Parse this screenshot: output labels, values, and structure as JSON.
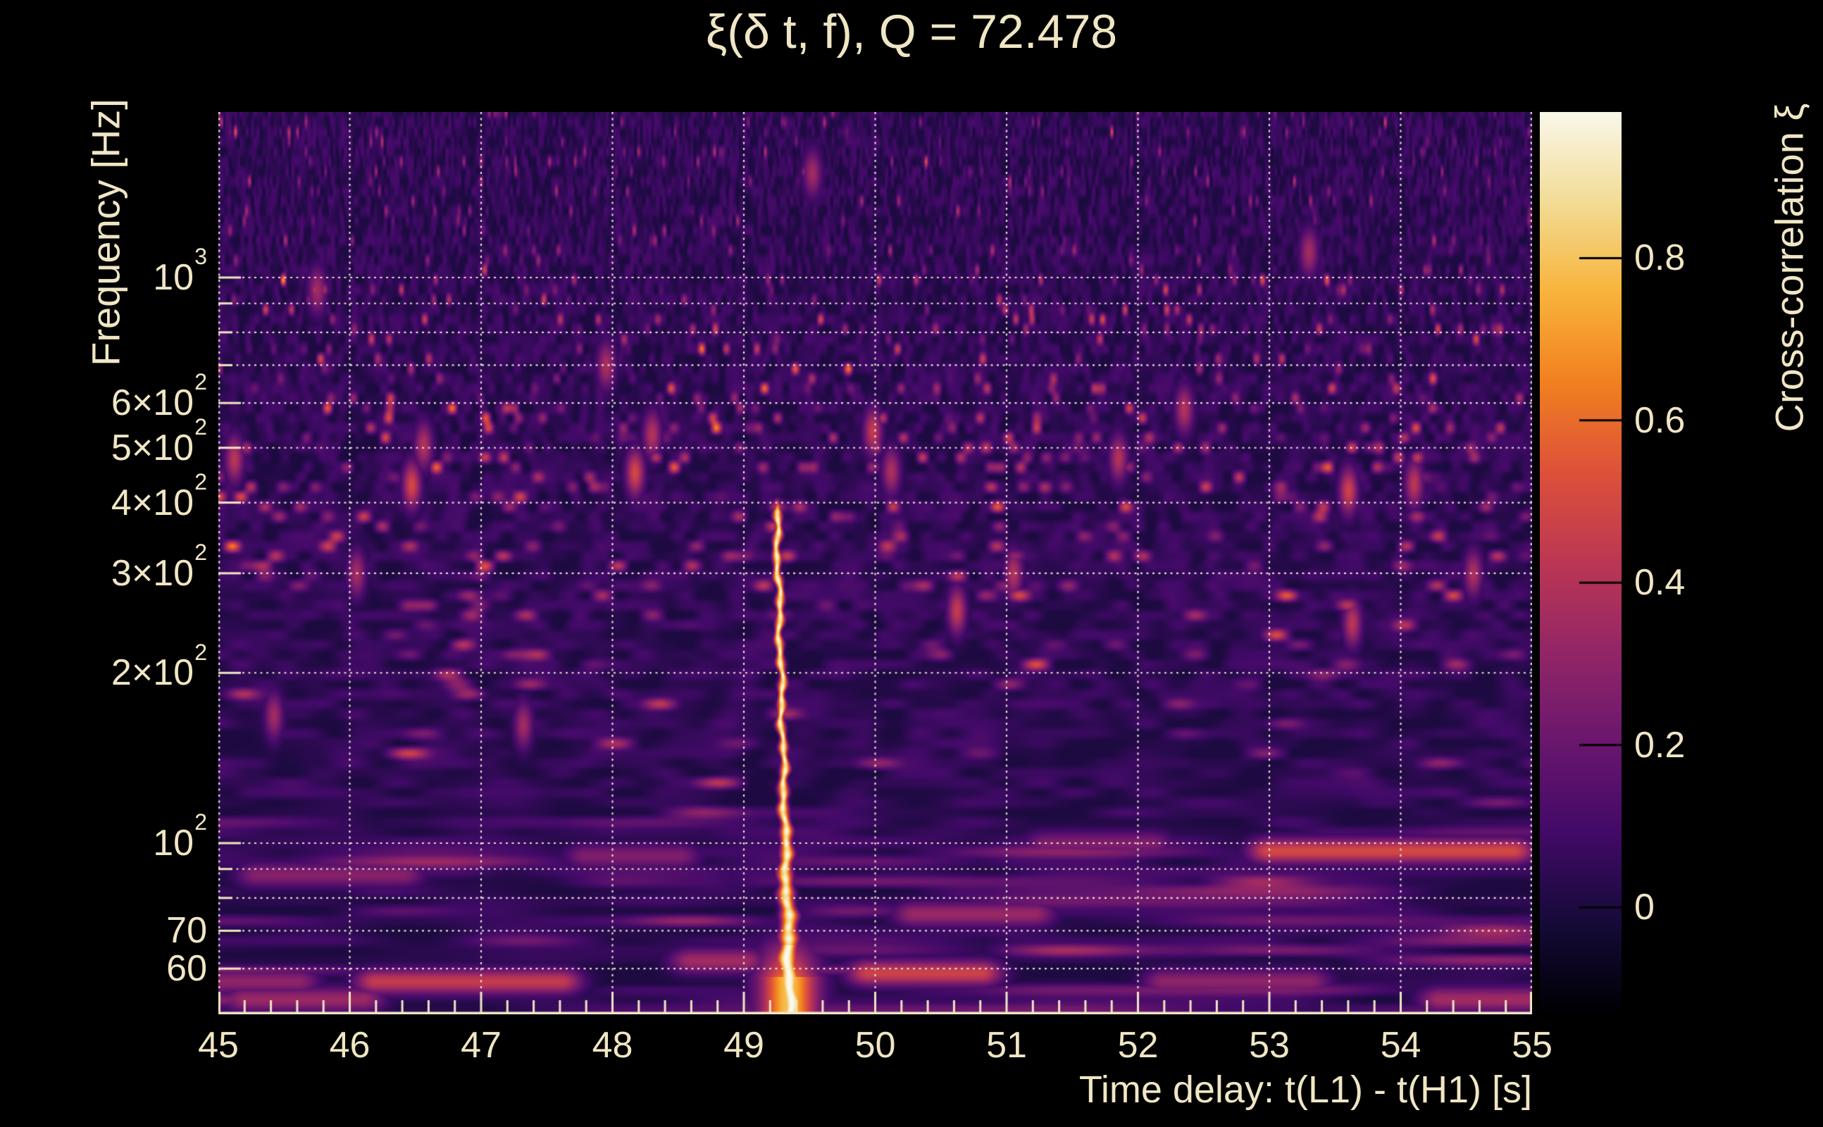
{
  "title": {
    "text": "ξ(δ t, f), Q = 72.478"
  },
  "x_axis": {
    "label": "Time delay: t(L1) - t(H1) [s]",
    "ticks": [
      {
        "t": 45,
        "label": "45"
      },
      {
        "t": 46,
        "label": "46"
      },
      {
        "t": 47,
        "label": "47"
      },
      {
        "t": 48,
        "label": "48"
      },
      {
        "t": 49,
        "label": "49"
      },
      {
        "t": 50,
        "label": "50"
      },
      {
        "t": 51,
        "label": "51"
      },
      {
        "t": 52,
        "label": "52"
      },
      {
        "t": 53,
        "label": "53"
      },
      {
        "t": 54,
        "label": "54"
      },
      {
        "t": 55,
        "label": "55"
      }
    ],
    "minor_step_s": 0.2,
    "gridline_times": [
      45,
      46,
      47,
      48,
      49,
      50,
      51,
      52,
      53,
      54,
      55
    ]
  },
  "y_axis": {
    "label": "Frequency [Hz]",
    "scale": "log",
    "ticks": [
      {
        "f": 1000,
        "m": "10",
        "e": "3"
      },
      {
        "f": 600,
        "m": "6×10",
        "e": "2"
      },
      {
        "f": 500,
        "m": "5×10",
        "e": "2"
      },
      {
        "f": 400,
        "m": "4×10",
        "e": "2"
      },
      {
        "f": 300,
        "m": "3×10",
        "e": "2"
      },
      {
        "f": 200,
        "m": "2×10",
        "e": "2"
      },
      {
        "f": 100,
        "m": "10",
        "e": "2"
      },
      {
        "f": 70,
        "m": "70"
      },
      {
        "f": 60,
        "m": "60"
      }
    ],
    "unlabeled_tick_freqs": [
      900,
      800,
      700,
      90,
      80
    ],
    "gridline_freqs": [
      60,
      70,
      80,
      90,
      100,
      200,
      300,
      400,
      500,
      600,
      700,
      800,
      900,
      1000
    ]
  },
  "colorbar": {
    "label": "Cross-correlation ξ",
    "ticks": [
      {
        "v": 0.8,
        "label": "0.8"
      },
      {
        "v": 0.6,
        "label": "0.6"
      },
      {
        "v": 0.4,
        "label": "0.4"
      },
      {
        "v": 0.2,
        "label": "0.2"
      },
      {
        "v": 0,
        "label": "0"
      }
    ],
    "vmin": -0.13,
    "vmax": 0.98,
    "colormap": "inferno-like (black → purple → red → orange → tan → white)"
  },
  "chart_data": {
    "type": "heatmap",
    "title": "ξ(δ t, f), Q = 72.478",
    "xlabel": "Time delay: t(L1) - t(H1) [s]",
    "ylabel": "Frequency [Hz]",
    "colorbar_label": "Cross-correlation ξ",
    "q_value": 72.478,
    "x_range_s": [
      45,
      55
    ],
    "y_range_hz": [
      49.8,
      1961
    ],
    "y_scale": "log",
    "color_range_xi": [
      -0.13,
      0.98
    ],
    "grid": "dotted cream gridlines at integer seconds and at log-decade frequencies",
    "legend_position": "right colorbar",
    "signal": {
      "description": "Narrow bright vertical ridge of high cross-correlation (the loudest event) at time delay ≈ 49.3 s, spanning ~50–410 Hz, saturating near ξ ≈ 0.95–1.0, wobbling slightly and widening/flaring below 70 Hz into a broad orange blob at the bottom edge",
      "t_at_400hz_s": 49.245,
      "t_at_55hz_s": 49.345,
      "freq_span_hz": [
        50,
        412
      ],
      "peak_xi": 0.97,
      "core_sigma_s_high_f": 0.02,
      "core_sigma_s_low_f": 0.053,
      "low_f_glow": {
        "below_hz": 72,
        "t_s": 49.33,
        "sigma_s": 0.16,
        "xi": 0.62
      },
      "bottom_flare": {
        "below_hz": 58,
        "t_s": 49.34,
        "sigma_s": 0.15,
        "xi": 0.8
      }
    },
    "noise": {
      "floor_xi_range": [
        -0.05,
        0.3
      ],
      "speckle_xi_range": [
        0.25,
        0.62
      ],
      "dark_band_hz": 60,
      "texture": "Q-transform tiling: tiles finer in time at high frequency, long horizontal smears below ~120 Hz"
    },
    "hotspots": [
      {
        "t_s": 46.47,
        "f_hz": 430,
        "xi": 0.5
      },
      {
        "t_s": 46.56,
        "f_hz": 505,
        "xi": 0.4
      },
      {
        "t_s": 45.12,
        "f_hz": 478,
        "xi": 0.42
      },
      {
        "t_s": 48.17,
        "f_hz": 452,
        "xi": 0.5
      },
      {
        "t_s": 48.3,
        "f_hz": 528,
        "xi": 0.4
      },
      {
        "t_s": 49.98,
        "f_hz": 535,
        "xi": 0.45
      },
      {
        "t_s": 50.12,
        "f_hz": 455,
        "xi": 0.38
      },
      {
        "t_s": 53.6,
        "f_hz": 420,
        "xi": 0.48
      },
      {
        "t_s": 53.63,
        "f_hz": 245,
        "xi": 0.42
      },
      {
        "t_s": 51.05,
        "f_hz": 300,
        "xi": 0.4
      },
      {
        "t_s": 50.62,
        "f_hz": 258,
        "xi": 0.45
      },
      {
        "t_s": 47.32,
        "f_hz": 162,
        "xi": 0.35
      },
      {
        "t_s": 45.42,
        "f_hz": 168,
        "xi": 0.35
      },
      {
        "t_s": 52.35,
        "f_hz": 585,
        "xi": 0.4
      },
      {
        "t_s": 54.1,
        "f_hz": 432,
        "xi": 0.42
      },
      {
        "t_s": 49.52,
        "f_hz": 1530,
        "xi": 0.35
      },
      {
        "t_s": 47.95,
        "f_hz": 700,
        "xi": 0.38
      },
      {
        "t_s": 51.85,
        "f_hz": 480,
        "xi": 0.4
      },
      {
        "t_s": 54.55,
        "f_hz": 300,
        "xi": 0.38
      },
      {
        "t_s": 46.05,
        "f_hz": 300,
        "xi": 0.36
      },
      {
        "t_s": 53.3,
        "f_hz": 1110,
        "xi": 0.36
      },
      {
        "t_s": 45.75,
        "f_hz": 950,
        "xi": 0.35
      }
    ],
    "streaks": [
      {
        "t_start_s": 46.2,
        "t_end_s": 47.6,
        "f_hz": 57,
        "xi": 0.45
      },
      {
        "t_start_s": 49.95,
        "t_end_s": 50.8,
        "f_hz": 59,
        "xi": 0.48
      },
      {
        "t_start_s": 53.0,
        "t_end_s": 54.85,
        "f_hz": 97,
        "xi": 0.5
      },
      {
        "t_start_s": 50.3,
        "t_end_s": 51.2,
        "f_hz": 75,
        "xi": 0.33
      },
      {
        "t_start_s": 45.2,
        "t_end_s": 46.1,
        "f_hz": 53,
        "xi": 0.33
      },
      {
        "t_start_s": 52.2,
        "t_end_s": 53.3,
        "f_hz": 57,
        "xi": 0.3
      },
      {
        "t_start_s": 45.3,
        "t_end_s": 46.4,
        "f_hz": 88,
        "xi": 0.28
      },
      {
        "t_start_s": 54.3,
        "t_end_s": 55.0,
        "f_hz": 53,
        "xi": 0.35
      },
      {
        "t_start_s": 48.6,
        "t_end_s": 49.0,
        "f_hz": 62,
        "xi": 0.35
      },
      {
        "t_start_s": 47.8,
        "t_end_s": 48.5,
        "f_hz": 95,
        "xi": 0.26
      },
      {
        "t_start_s": 51.3,
        "t_end_s": 52.1,
        "f_hz": 100,
        "xi": 0.26
      },
      {
        "t_start_s": 45.0,
        "t_end_s": 45.6,
        "f_hz": 57,
        "xi": 0.3
      }
    ]
  },
  "colors": {
    "background": "#000000",
    "text": "#f0e6c4",
    "grid": "#f3edd9",
    "tick": "#f0e6c4",
    "colorbar_tick": "#000000"
  }
}
